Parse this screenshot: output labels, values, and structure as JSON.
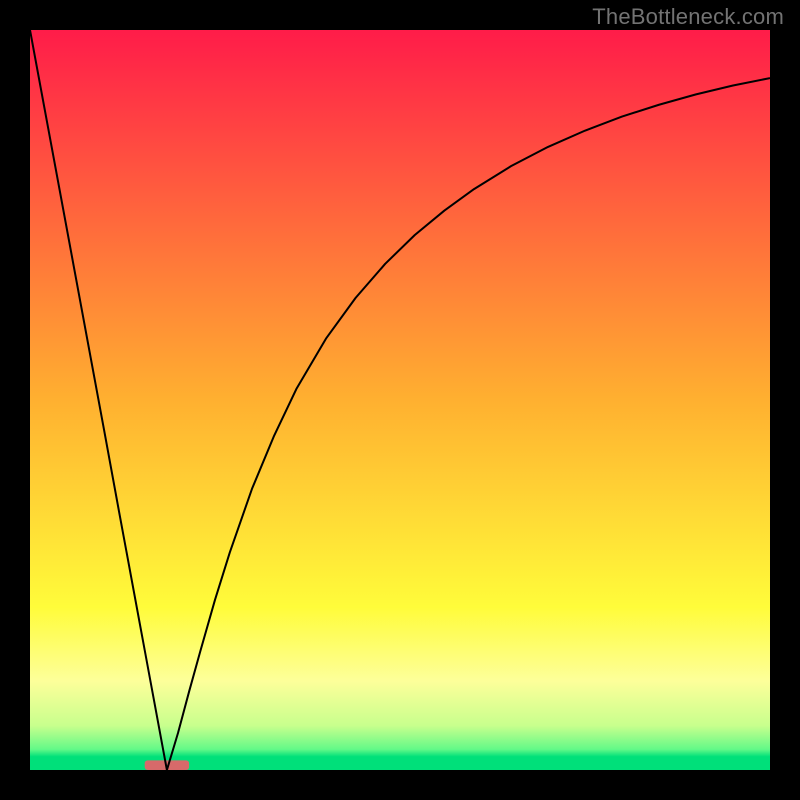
{
  "watermark": "TheBottleneck.com",
  "chart_data": {
    "type": "line",
    "title": "",
    "xlabel": "",
    "ylabel": "",
    "xlim": [
      0,
      100
    ],
    "ylim": [
      0,
      100
    ],
    "grid": false,
    "legend": false,
    "background_gradient": {
      "stops": [
        {
          "pos": 0.0,
          "color": "#ff1c49"
        },
        {
          "pos": 0.5,
          "color": "#ffb030"
        },
        {
          "pos": 0.78,
          "color": "#fffc3a"
        },
        {
          "pos": 0.88,
          "color": "#fdff9a"
        },
        {
          "pos": 0.94,
          "color": "#c8ff8d"
        },
        {
          "pos": 0.972,
          "color": "#63f988"
        },
        {
          "pos": 0.982,
          "color": "#00e07a"
        },
        {
          "pos": 1.0,
          "color": "#00e07a"
        }
      ]
    },
    "marker": {
      "x": 18.5,
      "y": 0,
      "width": 6,
      "height": 1.3,
      "color": "#d76a6a",
      "rx": 3
    },
    "series": [
      {
        "name": "curve",
        "color": "#000000",
        "stroke_width": 2,
        "x": [
          0,
          2,
          4,
          6,
          8,
          10,
          12,
          14,
          15.5,
          17,
          18.5,
          20,
          21.5,
          23,
          25,
          27,
          30,
          33,
          36,
          40,
          44,
          48,
          52,
          56,
          60,
          65,
          70,
          75,
          80,
          85,
          90,
          95,
          100
        ],
        "y": [
          100,
          89.2,
          78.4,
          67.6,
          56.8,
          46.0,
          35.1,
          24.3,
          16.2,
          8.1,
          0.0,
          5.0,
          10.6,
          16.0,
          23.0,
          29.4,
          38.0,
          45.2,
          51.5,
          58.3,
          63.8,
          68.4,
          72.3,
          75.6,
          78.5,
          81.6,
          84.2,
          86.4,
          88.3,
          89.9,
          91.3,
          92.5,
          93.5
        ]
      }
    ]
  }
}
